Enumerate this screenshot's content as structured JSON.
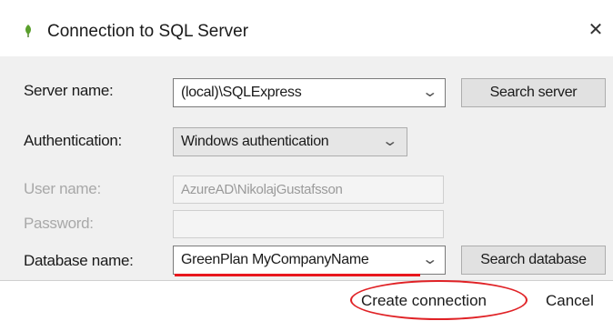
{
  "window": {
    "title": "Connection to SQL Server",
    "icon": "leaf-icon",
    "close_glyph": "✕"
  },
  "form": {
    "server": {
      "label": "Server name:",
      "value": "(local)\\SQLExpress",
      "button": "Search server"
    },
    "authentication": {
      "label": "Authentication:",
      "value": "Windows authentication"
    },
    "user": {
      "label": "User name:",
      "value": "AzureAD\\NikolajGustafsson"
    },
    "password": {
      "label": "Password:",
      "value": ""
    },
    "database": {
      "label": "Database name:",
      "value": "GreenPlan MyCompanyName",
      "button": "Search database"
    }
  },
  "footer": {
    "create_label": "Create connection",
    "cancel_label": "Cancel"
  },
  "colors": {
    "annotation_red": "#e02226",
    "icon_green": "#5aa02c"
  },
  "chevron_glyph": "⌄"
}
